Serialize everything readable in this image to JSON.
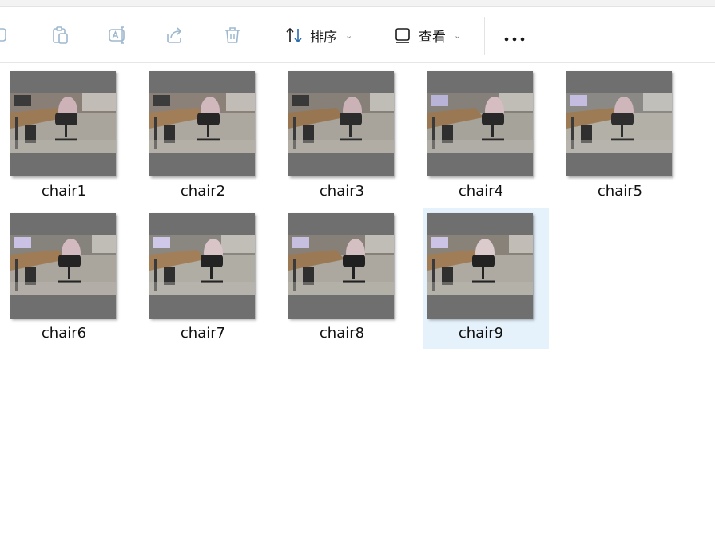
{
  "toolbar": {
    "sort_label": "排序",
    "view_label": "查看",
    "icons": [
      "copy-icon",
      "paste-icon",
      "rename-icon",
      "share-icon",
      "delete-icon",
      "sort-icon",
      "view-icon",
      "more-icon"
    ]
  },
  "files": [
    {
      "name": "chair1",
      "selected": false
    },
    {
      "name": "chair2",
      "selected": false
    },
    {
      "name": "chair3",
      "selected": false
    },
    {
      "name": "chair4",
      "selected": false
    },
    {
      "name": "chair5",
      "selected": false
    },
    {
      "name": "chair6",
      "selected": false
    },
    {
      "name": "chair7",
      "selected": false
    },
    {
      "name": "chair8",
      "selected": false
    },
    {
      "name": "chair9",
      "selected": true
    }
  ],
  "colors": {
    "selection": "#e5f1fb",
    "thumb_bg": "#6f6f6f",
    "icon_disabled": "#9db8cf",
    "icon_active": "#2b6cb0"
  }
}
